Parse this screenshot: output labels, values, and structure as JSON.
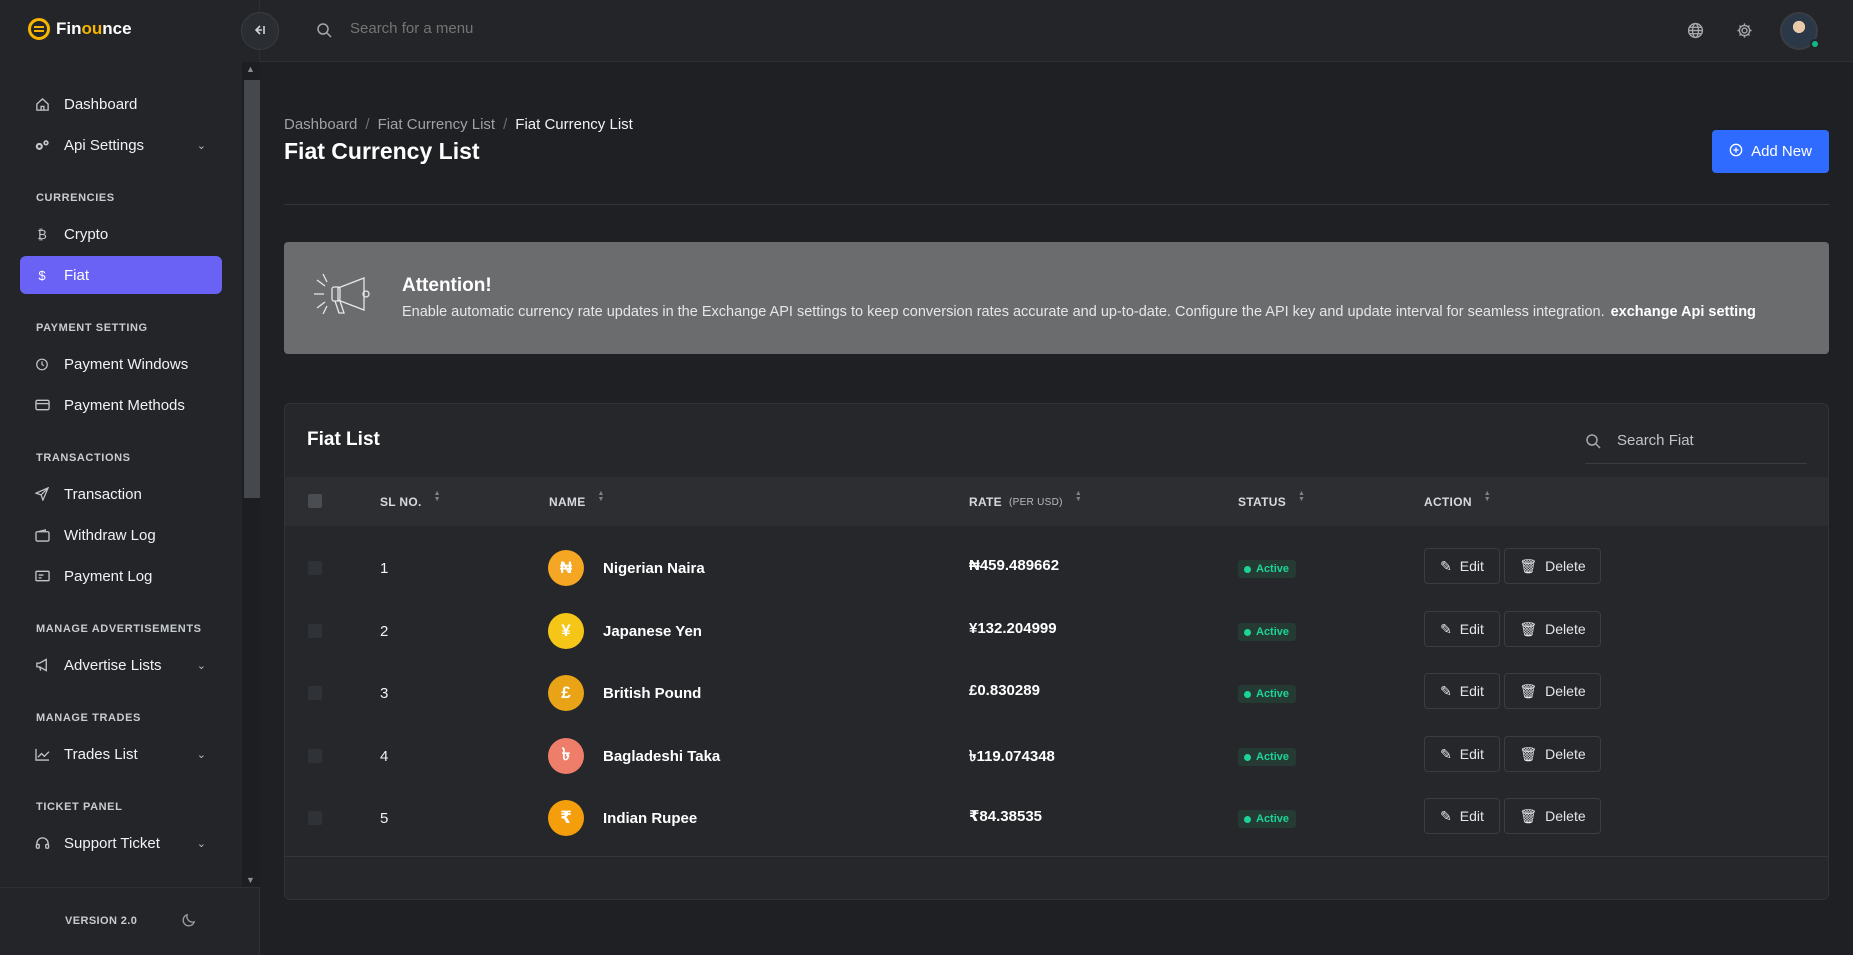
{
  "app": {
    "name_prefix": "Fin",
    "name_accent": "ou",
    "name_suffix": "nce"
  },
  "topbar": {
    "search_placeholder": "Search for a menu"
  },
  "sidebar": {
    "items_top": [
      {
        "label": "Dashboard",
        "icon": "home-icon"
      },
      {
        "label": "Api Settings",
        "icon": "gears-icon",
        "expandable": true
      }
    ],
    "sections": [
      {
        "title": "CURRENCIES",
        "items": [
          {
            "label": "Crypto",
            "icon": "bitcoin-icon"
          },
          {
            "label": "Fiat",
            "icon": "dollar-icon",
            "active": true
          }
        ]
      },
      {
        "title": "PAYMENT SETTING",
        "items": [
          {
            "label": "Payment Windows",
            "icon": "timer-icon"
          },
          {
            "label": "Payment Methods",
            "icon": "credit-card-icon"
          }
        ]
      },
      {
        "title": "TRANSACTIONS",
        "items": [
          {
            "label": "Transaction",
            "icon": "send-icon"
          },
          {
            "label": "Withdraw Log",
            "icon": "wallet-icon"
          },
          {
            "label": "Payment Log",
            "icon": "receipt-icon"
          }
        ]
      },
      {
        "title": "MANAGE ADVERTISEMENTS",
        "items": [
          {
            "label": "Advertise Lists",
            "icon": "megaphone-icon",
            "expandable": true
          }
        ]
      },
      {
        "title": "MANAGE TRADES",
        "items": [
          {
            "label": "Trades List",
            "icon": "chart-line-icon",
            "expandable": true
          }
        ]
      },
      {
        "title": "TICKET PANEL",
        "items": [
          {
            "label": "Support Ticket",
            "icon": "headset-icon",
            "expandable": true
          }
        ]
      }
    ],
    "version": "VERSION 2.0"
  },
  "breadcrumb": [
    "Dashboard",
    "Fiat Currency List",
    "Fiat Currency List"
  ],
  "page": {
    "title": "Fiat Currency List",
    "add_label": "Add New"
  },
  "alert": {
    "title": "Attention!",
    "text": "Enable automatic currency rate updates in the Exchange API settings to keep conversion rates accurate and up-to-date. Configure the API key and update interval for seamless integration.",
    "link": "exchange Api setting"
  },
  "fiat_list": {
    "title": "Fiat List",
    "search_placeholder": "Search Fiat",
    "columns": {
      "sl": "SL NO.",
      "name": "NAME",
      "rate": "RATE",
      "rate_sub": "(PER USD)",
      "status": "STATUS",
      "action": "ACTION"
    },
    "rows": [
      {
        "sl": "1",
        "name": "Nigerian Naira",
        "rate": "₦459.489662",
        "status": "Active",
        "symbol": "₦",
        "color": "#f5a623"
      },
      {
        "sl": "2",
        "name": "Japanese Yen",
        "rate": "¥132.204999",
        "status": "Active",
        "symbol": "¥",
        "color": "#f5c518"
      },
      {
        "sl": "3",
        "name": "British Pound",
        "rate": "£0.830289",
        "status": "Active",
        "symbol": "£",
        "color": "#e8a317"
      },
      {
        "sl": "4",
        "name": "Bagladeshi Taka",
        "rate": "৳119.074348",
        "status": "Active",
        "symbol": "৳",
        "color": "#ee7d6a"
      },
      {
        "sl": "5",
        "name": "Indian Rupee",
        "rate": "₹84.38535",
        "status": "Active",
        "symbol": "₹",
        "color": "#f59e0b"
      }
    ],
    "edit_label": "Edit",
    "delete_label": "Delete"
  }
}
